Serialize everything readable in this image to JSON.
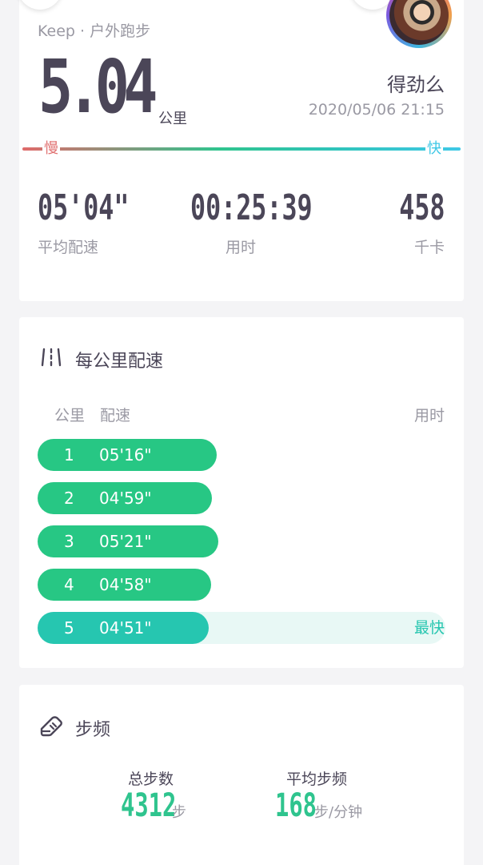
{
  "summary": {
    "subtitle": "Keep · 户外跑步",
    "distance": "5.04",
    "distance_unit": "公里",
    "motto": "得劲么",
    "datetime": "2020/05/06 21:15",
    "slow_label": "慢",
    "fast_label": "快",
    "stats": [
      {
        "value": "05'04\"",
        "label": "平均配速"
      },
      {
        "value": "00:25:39",
        "label": "用时"
      },
      {
        "value": "458",
        "label": "千卡"
      }
    ]
  },
  "pace_section": {
    "title": "每公里配速",
    "icon": "road-icon",
    "headers": {
      "km": "公里",
      "pace": "配速",
      "time": "用时"
    },
    "rows": [
      {
        "km": "1",
        "pace": "05'16\"",
        "bar_fraction": 0.44,
        "fastest": false
      },
      {
        "km": "2",
        "pace": "04'59\"",
        "bar_fraction": 0.427,
        "fastest": false
      },
      {
        "km": "3",
        "pace": "05'21\"",
        "bar_fraction": 0.443,
        "fastest": false
      },
      {
        "km": "4",
        "pace": "04'58\"",
        "bar_fraction": 0.425,
        "fastest": false
      },
      {
        "km": "5",
        "pace": "04'51\"",
        "bar_fraction": 0.42,
        "fastest": true
      }
    ],
    "fastest_label": "最快"
  },
  "cadence_section": {
    "title": "步频",
    "icon": "shoe-icon",
    "total_steps_label": "总步数",
    "total_steps_value": "4312",
    "total_steps_unit": "步",
    "avg_cadence_label": "平均步频",
    "avg_cadence_value": "168",
    "avg_cadence_unit": "步/分钟"
  },
  "colors": {
    "accent_green": "#27c784",
    "accent_teal": "#26c6b0",
    "slow_red": "#e06a6a",
    "fast_blue": "#3fc8e6"
  }
}
